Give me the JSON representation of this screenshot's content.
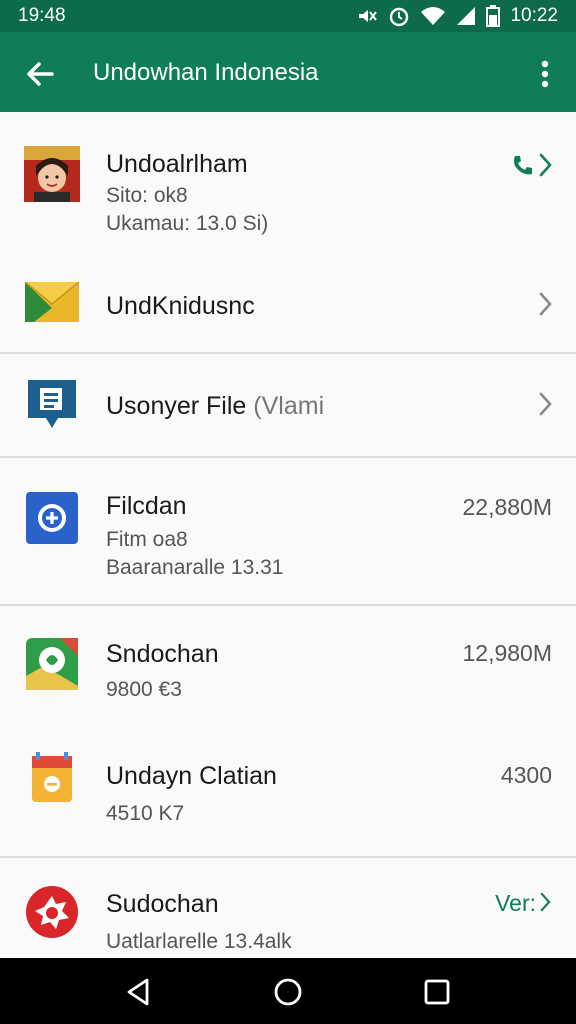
{
  "status_bar": {
    "time_left": "19:48",
    "time_right": "10:22",
    "icons": [
      "mute-icon",
      "alarm-icon",
      "wifi-icon",
      "signal-icon",
      "battery-icon"
    ]
  },
  "app_bar": {
    "title": "Undowhan Indonesia",
    "background": "#0f7d5a"
  },
  "items": [
    {
      "icon": "user-photo-icon",
      "title": "Undoalrlham",
      "lines": [
        "Sito: ok8",
        "Ukamau: 13.0 Si)"
      ],
      "right_icon": "phone-icon"
    },
    {
      "icon": "mail-icon",
      "title": "UndKnidusnc"
    },
    {
      "icon": "file-speech-icon",
      "title": "Usonyer File",
      "title_suffix": "(Vlami"
    },
    {
      "icon": "location-pin-icon",
      "title": "Filcdan",
      "lines": [
        "Fitm oa8",
        "Baaranaralle 13.31"
      ],
      "right_text": "22,880M"
    },
    {
      "icon": "maps-icon",
      "title": "Sndochan",
      "lines": [
        "9800 €3"
      ],
      "right_text": "12,980M"
    },
    {
      "icon": "calendar-icon",
      "title": "Undayn Clatian",
      "lines": [
        "4510 K7"
      ],
      "right_text": "4300"
    },
    {
      "icon": "settings-badge-icon",
      "title": "Sudochan",
      "lines": [
        "Uatlarlarelle 13.4alk"
      ],
      "right_text": "Ver:"
    }
  ],
  "nav_bar": {
    "buttons": [
      "back-triangle-icon",
      "home-circle-icon",
      "recents-square-icon"
    ]
  },
  "colors": {
    "primary": "#0f7d5a",
    "status": "#0d6b4c"
  }
}
